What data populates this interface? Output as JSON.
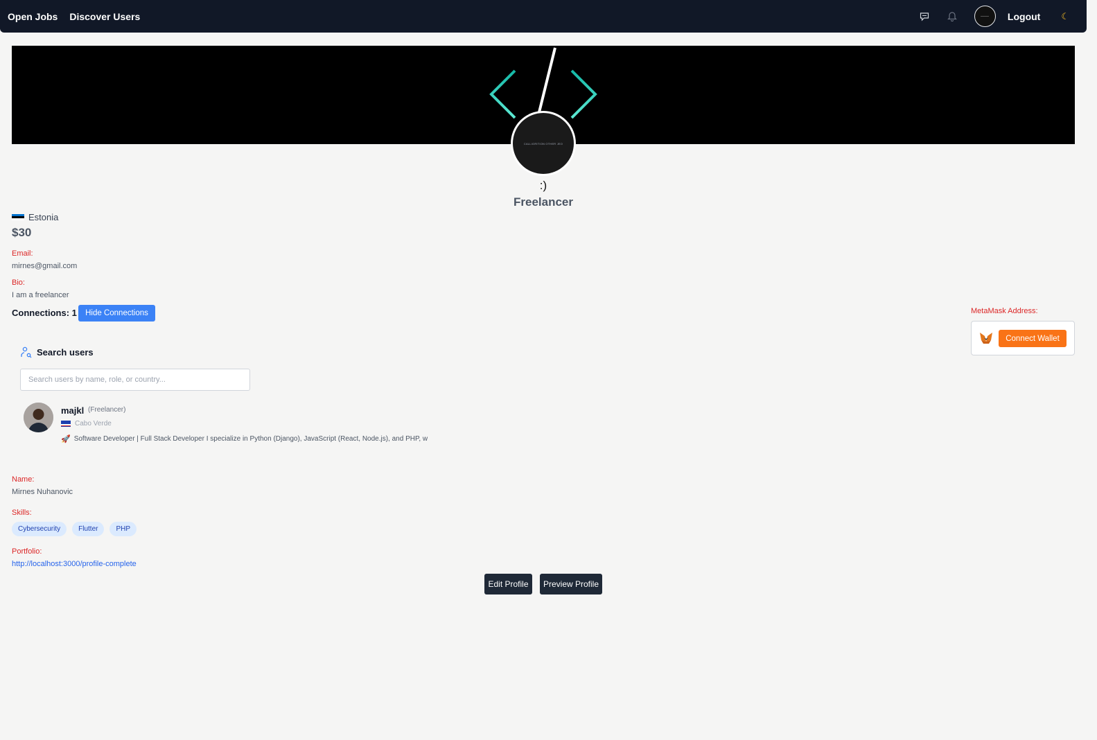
{
  "nav": {
    "open_jobs": "Open Jobs",
    "discover_users": "Discover Users",
    "logout": "Logout"
  },
  "banner": {
    "avatar_text": "CALLIGRITION OTHER JEO"
  },
  "profile": {
    "display_name": ":)",
    "role": "Freelancer",
    "country": "Estonia",
    "rate": "$30",
    "email_label": "Email:",
    "email": "mirnes@gmail.com",
    "bio_label": "Bio:",
    "bio": "I am a freelancer",
    "connections": "Connections: 1",
    "hide_connections": "Hide Connections",
    "name_label": "Name:",
    "name": "Mirnes Nuhanovic",
    "skills_label": "Skills:",
    "skills": [
      "Cybersecurity",
      "Flutter",
      "PHP"
    ],
    "portfolio_label": "Portfolio:",
    "portfolio": "http://localhost:3000/profile-complete",
    "edit_profile": "Edit Profile",
    "preview_profile": "Preview Profile"
  },
  "search": {
    "title": "Search users",
    "placeholder": "Search users by name, role, or country..."
  },
  "users": [
    {
      "name": "majkl",
      "role": "(Freelancer)",
      "country": "Cabo Verde",
      "bio": "Software Developer | Full Stack Developer I specialize in Python (Django), JavaScript (React, Node.js), and PHP, w"
    }
  ],
  "metamask": {
    "label": "MetaMask Address:",
    "connect": "Connect Wallet"
  },
  "colors": {
    "navbar": "#111827",
    "accent_blue": "#3b82f6",
    "metamask_orange": "#f97316",
    "label_red": "#dc2626"
  }
}
